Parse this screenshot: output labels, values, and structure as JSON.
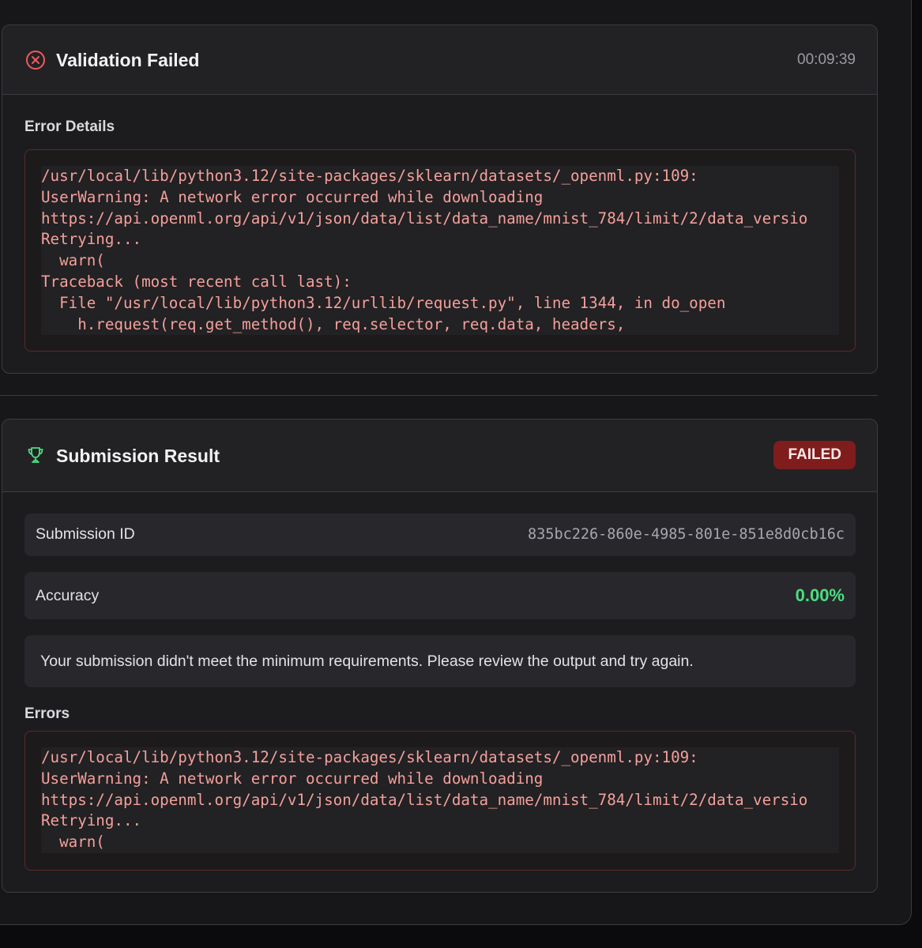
{
  "validation": {
    "title": "Validation Failed",
    "elapsed": "00:09:39",
    "icon": "x-circle-icon",
    "error_details_label": "Error Details",
    "error_lines": [
      "/usr/local/lib/python3.12/site-packages/sklearn/datasets/_openml.py:109:",
      "UserWarning: A network error occurred while downloading",
      "https://api.openml.org/api/v1/json/data/list/data_name/mnist_784/limit/2/data_versio",
      "Retrying...",
      "  warn(",
      "Traceback (most recent call last):",
      "  File \"/usr/local/lib/python3.12/urllib/request.py\", line 1344, in do_open",
      "    h.request(req.get_method(), req.selector, req.data, headers,"
    ]
  },
  "submission": {
    "title": "Submission Result",
    "icon": "trophy-icon",
    "status": "FAILED",
    "id_label": "Submission ID",
    "id_value": "835bc226-860e-4985-801e-851e8d0cb16c",
    "accuracy_label": "Accuracy",
    "accuracy_value": "0.00%",
    "message": "Your submission didn't meet the minimum requirements. Please review the output and try again.",
    "errors_label": "Errors",
    "errors_lines": [
      "/usr/local/lib/python3.12/site-packages/sklearn/datasets/_openml.py:109:",
      "UserWarning: A network error occurred while downloading",
      "https://api.openml.org/api/v1/json/data/list/data_name/mnist_784/limit/2/data_versio",
      "Retrying...",
      "  warn("
    ]
  },
  "colors": {
    "error_red": "#ef5b5b",
    "success_green": "#4ade80",
    "badge_bg": "#7f1d1d",
    "code_text": "#f4a09a"
  }
}
